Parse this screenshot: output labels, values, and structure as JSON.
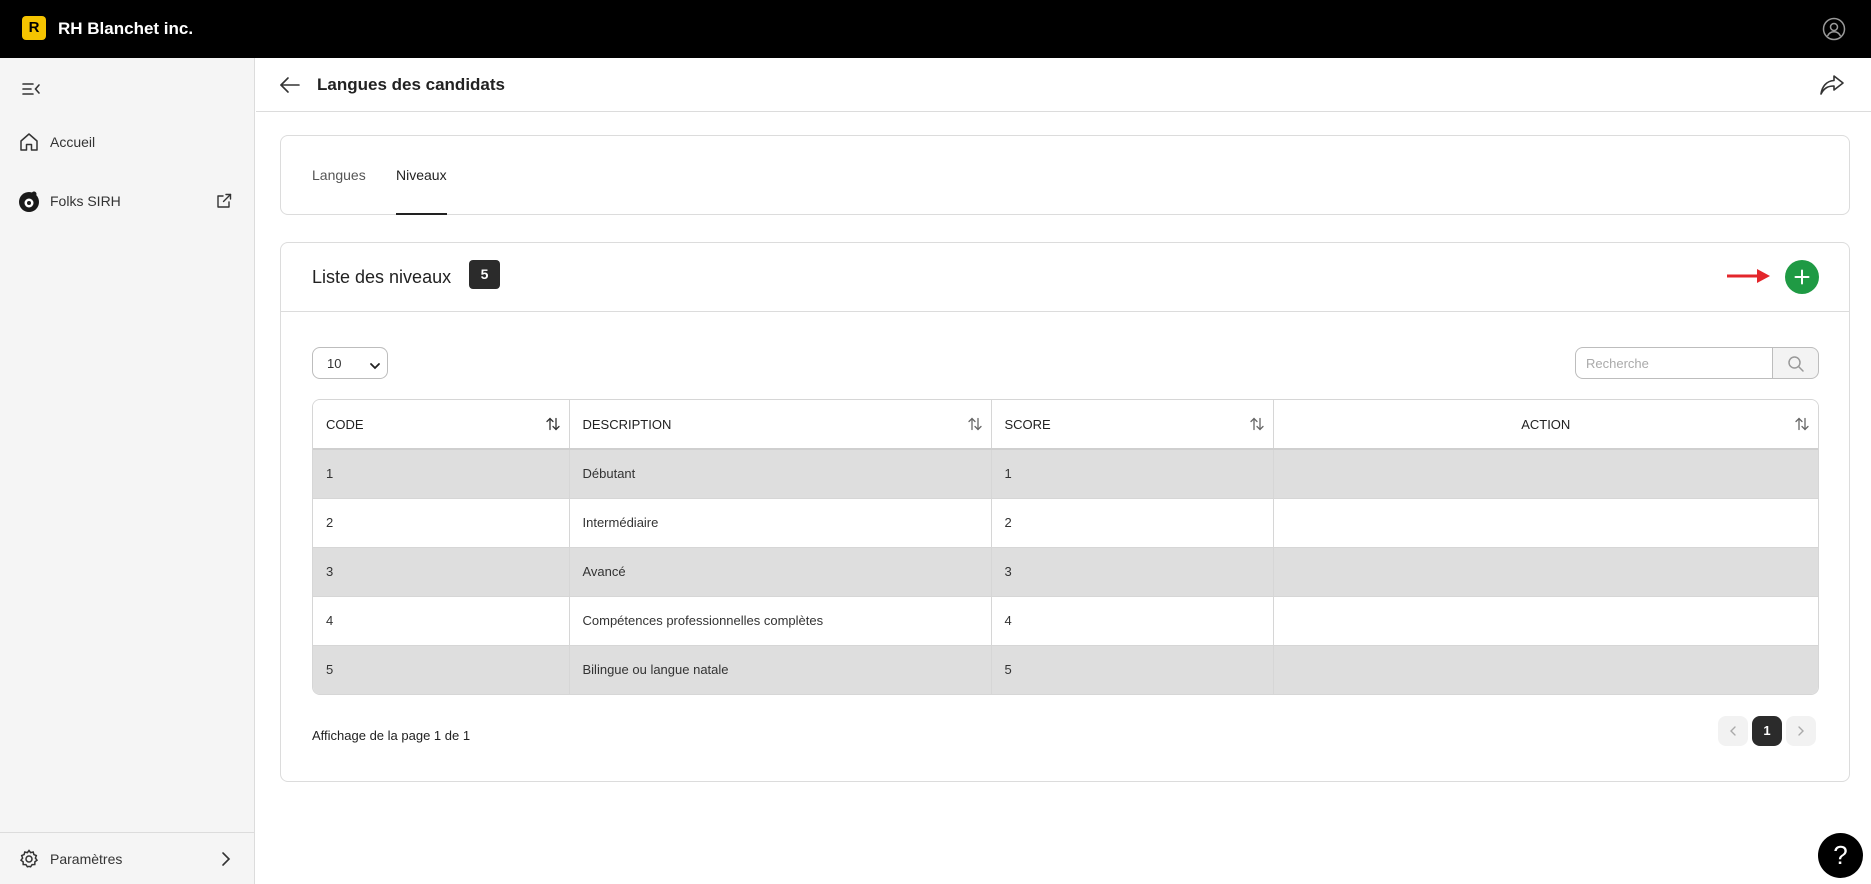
{
  "app": {
    "logo_letter": "R",
    "name": "RH Blanchet inc."
  },
  "sidebar": {
    "items": [
      {
        "label": "Accueil",
        "icon": "home-icon"
      },
      {
        "label": "Folks SIRH",
        "icon": "folks-logo-icon",
        "external": true
      }
    ],
    "settings_label": "Paramètres"
  },
  "header": {
    "title": "Langues des candidats"
  },
  "tabs": [
    {
      "label": "Langues",
      "active": false
    },
    {
      "label": "Niveaux",
      "active": true
    }
  ],
  "list": {
    "title": "Liste des niveaux",
    "count": "5",
    "page_size": "10",
    "search_placeholder": "Recherche",
    "columns": [
      "CODE",
      "DESCRIPTION",
      "SCORE",
      "ACTION"
    ],
    "rows": [
      {
        "code": "1",
        "description": "Débutant",
        "score": "1",
        "action": ""
      },
      {
        "code": "2",
        "description": "Intermédiaire",
        "score": "2",
        "action": ""
      },
      {
        "code": "3",
        "description": "Avancé",
        "score": "3",
        "action": ""
      },
      {
        "code": "4",
        "description": "Compétences professionnelles complètes",
        "score": "4",
        "action": ""
      },
      {
        "code": "5",
        "description": "Bilingue ou langue natale",
        "score": "5",
        "action": ""
      }
    ],
    "pagination_info": "Affichage de la page 1 de 1",
    "current_page": "1"
  },
  "help": {
    "label": "?"
  },
  "colors": {
    "topbar": "#000000",
    "brand_logo": "#f5c400",
    "add_button": "#1f9a44",
    "annotation_arrow": "#e3262b",
    "row_shade": "#dedede"
  }
}
